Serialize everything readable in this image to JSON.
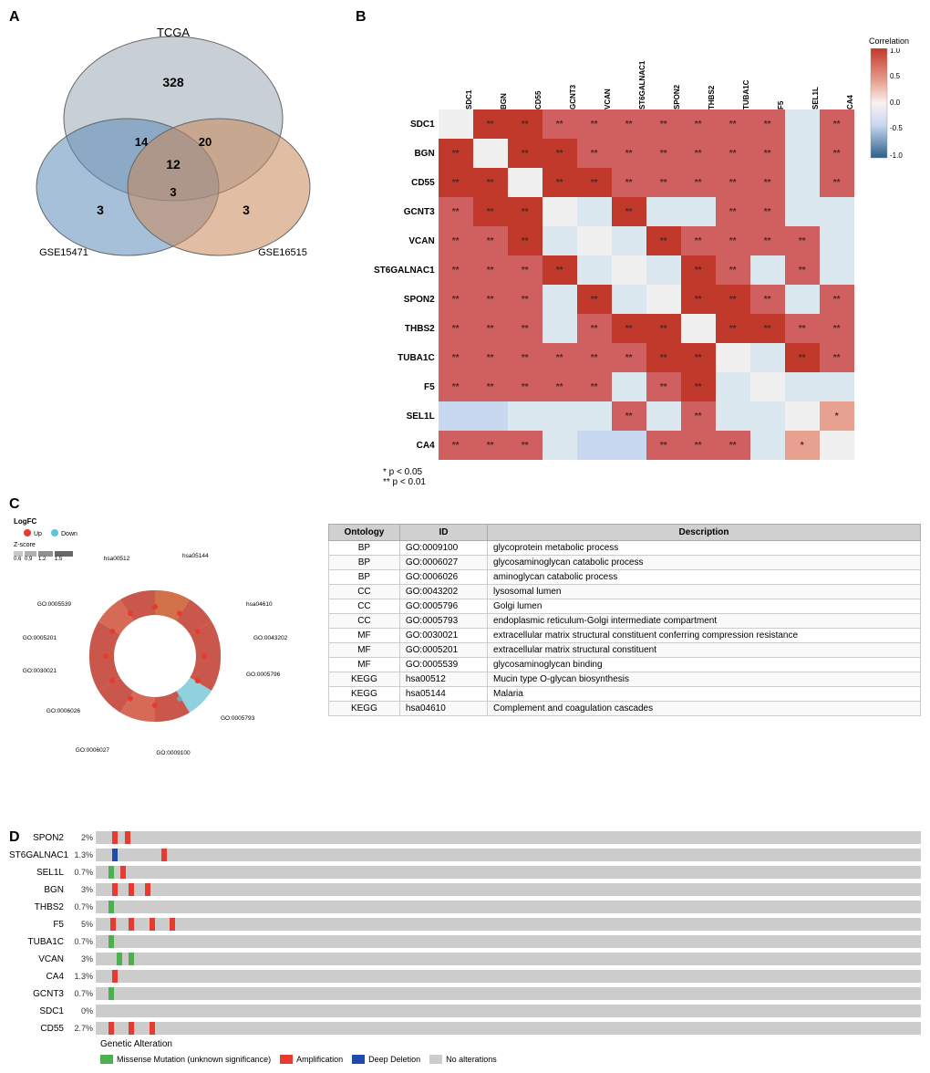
{
  "panels": {
    "a_label": "A",
    "b_label": "B",
    "c_label": "C",
    "d_label": "D"
  },
  "venn": {
    "tcga_label": "TCGA",
    "gse15471_label": "GSE15471",
    "gse16515_label": "GSE16515",
    "tcga_only": "328",
    "gse15471_only": "3",
    "gse16515_only": "3",
    "tcga_gse15471": "14",
    "tcga_gse16515": "20",
    "gse15471_gse16515": "3",
    "center": "12"
  },
  "correlation": {
    "title": "Correlation",
    "sig1": "* p < 0.05",
    "sig2": "** p < 0.01",
    "scale_max": "1.0",
    "scale_05": "0.5",
    "scale_0": "0.0",
    "scale_n05": "-0.5",
    "scale_n10": "-1.0",
    "genes": [
      "SDC1",
      "BGN",
      "CD55",
      "GCNT3",
      "VCAN",
      "ST6GALNAC1",
      "SPON2",
      "THBS2",
      "TUBA1C",
      "F5",
      "SEL1L",
      "CA4"
    ],
    "matrix": {
      "SDC1": [
        null,
        "**",
        "**",
        "**",
        "**",
        "**",
        "**",
        "**",
        "**",
        "**",
        "",
        "**"
      ],
      "BGN": [
        "**",
        null,
        "**",
        "**",
        "**",
        "**",
        "**",
        "**",
        "**",
        "**",
        "",
        "**"
      ],
      "CD55": [
        "**",
        "**",
        null,
        "**",
        "**",
        "**",
        "**",
        "**",
        "**",
        "**",
        "",
        "**"
      ],
      "GCNT3": [
        "**",
        "**",
        "**",
        null,
        "",
        "**",
        "",
        "",
        "**",
        "**",
        "",
        ""
      ],
      "VCAN": [
        "**",
        "**",
        "**",
        "",
        null,
        "",
        "**",
        "**",
        "**",
        "**",
        "**",
        ""
      ],
      "ST6GALNAC1": [
        "**",
        "**",
        "**",
        "**",
        "",
        null,
        "",
        "**",
        "**",
        "",
        "**",
        ""
      ],
      "SPON2": [
        "**",
        "**",
        "**",
        "",
        "**",
        "",
        null,
        "**",
        "**",
        "**",
        "",
        "**"
      ],
      "THBS2": [
        "**",
        "**",
        "**",
        "",
        "**",
        "**",
        "**",
        null,
        "**",
        "**",
        "**",
        "**"
      ],
      "TUBA1C": [
        "**",
        "**",
        "**",
        "**",
        "**",
        "**",
        "**",
        "**",
        null,
        "",
        "**",
        "**"
      ],
      "F5": [
        "**",
        "**",
        "**",
        "**",
        "**",
        "",
        "**",
        "**",
        "",
        null,
        "",
        ""
      ],
      "SEL1L": [
        "",
        "",
        "",
        "",
        "",
        "**",
        "",
        "**",
        "",
        "",
        null,
        "*"
      ],
      "CA4": [
        "**",
        "**",
        "**",
        "",
        "",
        "",
        "**",
        "**",
        "**",
        "",
        "*",
        null
      ]
    },
    "colors": {
      "strong_pos": "#c0392b",
      "med_pos": "#e8807a",
      "light_pos": "#f5c5c0",
      "neutral": "#faf0f0",
      "light_neg": "#c8d8f0",
      "med_neg": "#7090c0",
      "strong_neg": "#2c5f8a"
    }
  },
  "go_table": {
    "headers": [
      "Ontology",
      "ID",
      "Description"
    ],
    "rows": [
      [
        "BP",
        "GO:0009100",
        "glycoprotein metabolic process"
      ],
      [
        "BP",
        "GO:0006027",
        "glycosaminoglycan catabolic process"
      ],
      [
        "BP",
        "GO:0006026",
        "aminoglycan catabolic process"
      ],
      [
        "CC",
        "GO:0043202",
        "lysosomal lumen"
      ],
      [
        "CC",
        "GO:0005796",
        "Golgi lumen"
      ],
      [
        "CC",
        "GO:0005793",
        "endoplasmic reticulum-Golgi intermediate compartment"
      ],
      [
        "MF",
        "GO:0030021",
        "extracellular matrix structural constituent conferring compression resistance"
      ],
      [
        "MF",
        "GO:0005201",
        "extracellular matrix structural constituent"
      ],
      [
        "MF",
        "GO:0005539",
        "glycosaminoglycan binding"
      ],
      [
        "KEGG",
        "hsa00512",
        "Mucin type O-glycan biosynthesis"
      ],
      [
        "KEGG",
        "hsa05144",
        "Malaria"
      ],
      [
        "KEGG",
        "hsa04610",
        "Complement and coagulation cascades"
      ]
    ]
  },
  "logfc_legend": {
    "title": "LogFC",
    "up": "Up",
    "down": "Down"
  },
  "zscore_legend": {
    "label": "Z-score",
    "ticks": [
      "0.6",
      "0.9",
      "1.2",
      "1.5"
    ]
  },
  "oncoprint": {
    "genes": [
      {
        "name": "SPON2",
        "pct": "2%"
      },
      {
        "name": "ST6GALNAC1",
        "pct": "1.3%"
      },
      {
        "name": "SEL1L",
        "pct": "0.7%"
      },
      {
        "name": "BGN",
        "pct": "3%"
      },
      {
        "name": "THBS2",
        "pct": "0.7%"
      },
      {
        "name": "F5",
        "pct": "5%"
      },
      {
        "name": "TUBA1C",
        "pct": "0.7%"
      },
      {
        "name": "VCAN",
        "pct": "3%"
      },
      {
        "name": "CA4",
        "pct": "1.3%"
      },
      {
        "name": "GCNT3",
        "pct": "0.7%"
      },
      {
        "name": "SDC1",
        "pct": "0%"
      },
      {
        "name": "CD55",
        "pct": "2.7%"
      }
    ],
    "legend": {
      "missense": "Missense Mutation (unknown significance)",
      "amplification": "Amplification",
      "deep_deletion": "Deep Deletion",
      "no_alteration": "No alterations"
    },
    "x_label": "Genetic Alteration"
  },
  "circular_labels": [
    "GO:0043202",
    "GO:0005796",
    "GO:0005793",
    "GO:0009100",
    "GO:0006027",
    "GO:0006026",
    "GO:0030021",
    "GO:0005201",
    "GO:0005539",
    "hsa00512",
    "hsa05144",
    "hsa04610"
  ]
}
